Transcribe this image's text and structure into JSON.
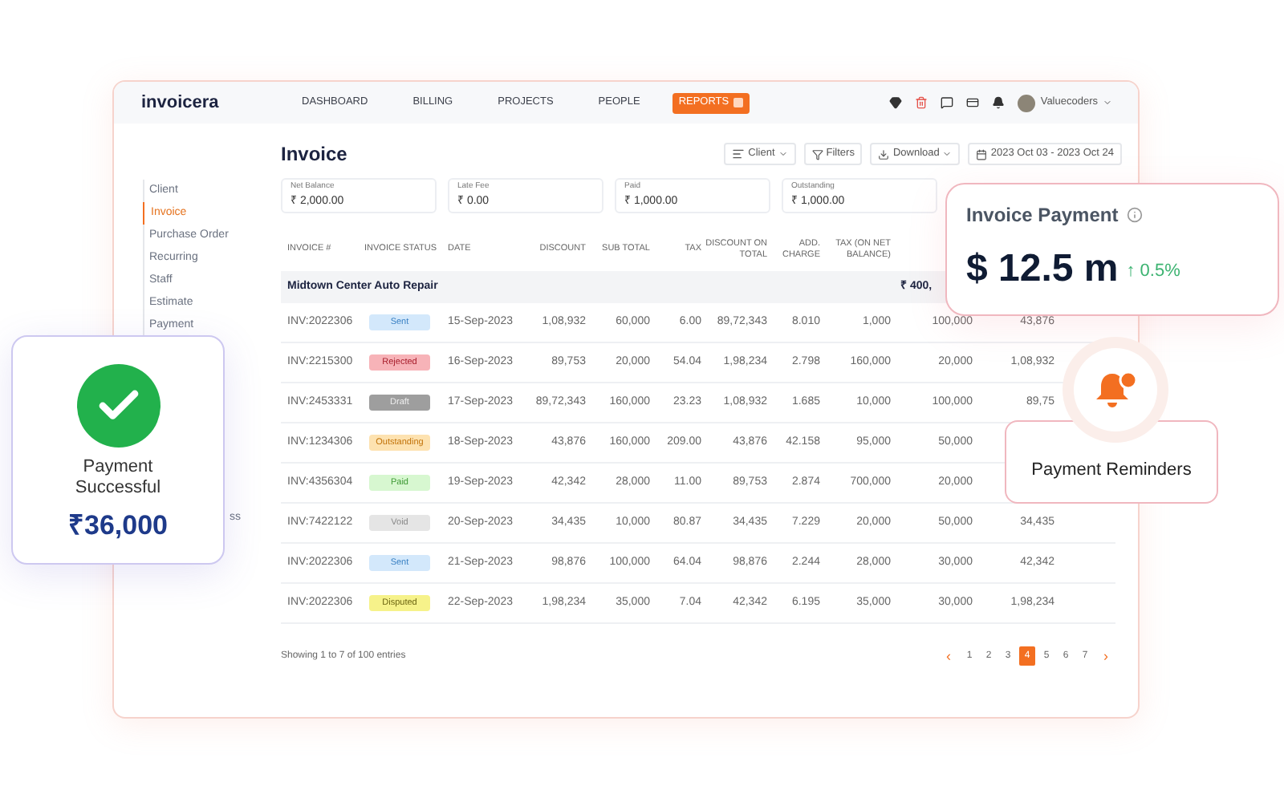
{
  "brand": "invoicera",
  "nav": [
    {
      "label": "DASHBOARD",
      "selected": false
    },
    {
      "label": "BILLING",
      "selected": false
    },
    {
      "label": "PROJECTS",
      "selected": false
    },
    {
      "label": "PEOPLE",
      "selected": false
    },
    {
      "label": "REPORTS",
      "selected": true
    }
  ],
  "user": "Valuecoders",
  "sidebar": [
    {
      "label": "Client",
      "selected": false,
      "clipped": false
    },
    {
      "label": "Invoice",
      "selected": true,
      "clipped": false
    },
    {
      "label": "Purchase Order",
      "selected": false,
      "clipped": false
    },
    {
      "label": "Recurring",
      "selected": false,
      "clipped": false
    },
    {
      "label": "Staff",
      "selected": false,
      "clipped": false
    },
    {
      "label": "Estimate",
      "selected": false,
      "clipped": false
    },
    {
      "label": "Payment",
      "selected": false,
      "clipped": false
    },
    {
      "label": "ss",
      "selected": false,
      "clipped": true
    }
  ],
  "page_title": "Invoice",
  "filters": [
    {
      "label": "Client",
      "kind": "dropdown"
    },
    {
      "label": "Filters",
      "kind": "filter"
    },
    {
      "label": "Download",
      "kind": "download"
    },
    {
      "label": "2023 Oct 03 - 2023 Oct 24",
      "kind": "date"
    }
  ],
  "summary": [
    {
      "label": "Net Balance",
      "value": "₹ 2,000.00"
    },
    {
      "label": "Late Fee",
      "value": "₹ 0.00"
    },
    {
      "label": "Paid",
      "value": "₹ 1,000.00"
    },
    {
      "label": "Outstanding",
      "value": "₹ 1,000.00"
    }
  ],
  "table": {
    "columns": [
      "INVOICE #",
      "INVOICE STATUS",
      "DATE",
      "DISCOUNT",
      "SUB TOTAL",
      "TAX",
      "DISCOUNT ON TOTAL",
      "ADD. CHARGE",
      "TAX (ON NET BALANCE)"
    ],
    "group": {
      "name": "Midtown Center Auto Repair",
      "amount": "₹ 400,"
    },
    "rows": [
      {
        "cells": [
          "INV:2022306",
          {
            "label": "Sent",
            "kind": "sent",
            "color": "#d3e8fb"
          },
          "15-Sep-2023",
          "1,08,932",
          "60,000",
          "6.00",
          "89,72,343",
          "8.010",
          "1,000",
          "100,000",
          "43,876"
        ]
      },
      {
        "cells": [
          "INV:2215300",
          {
            "label": "Rejected",
            "kind": "rejected",
            "color": "#f7b3b8"
          },
          "16-Sep-2023",
          "89,753",
          "20,000",
          "54.04",
          "1,98,234",
          "2.798",
          "160,000",
          "20,000",
          "1,08,932"
        ]
      },
      {
        "cells": [
          "INV:2453331",
          {
            "label": "Draft",
            "kind": "draft",
            "color": "#9e9e9e"
          },
          "17-Sep-2023",
          "89,72,343",
          "160,000",
          "23.23",
          "1,08,932",
          "1.685",
          "10,000",
          "100,000",
          "89,75"
        ]
      },
      {
        "cells": [
          "INV:1234306",
          {
            "label": "Outstanding",
            "kind": "outstanding",
            "color": "#fde2b0"
          },
          "18-Sep-2023",
          "43,876",
          "160,000",
          "209.00",
          "43,876",
          "42.158",
          "95,000",
          "50,000"
        ]
      },
      {
        "cells": [
          "INV:4356304",
          {
            "label": "Paid",
            "kind": "paid",
            "color": "#d7f7d0"
          },
          "19-Sep-2023",
          "42,342",
          "28,000",
          "11.00",
          "89,753",
          "2.874",
          "700,000",
          "20,000"
        ]
      },
      {
        "cells": [
          "INV:7422122",
          {
            "label": "Void",
            "kind": "void",
            "color": "#e5e5e5"
          },
          "20-Sep-2023",
          "34,435",
          "10,000",
          "80.87",
          "34,435",
          "7.229",
          "20,000",
          "50,000",
          "34,435"
        ]
      },
      {
        "cells": [
          "INV:2022306",
          {
            "label": "Sent",
            "kind": "sent",
            "color": "#d3e8fb"
          },
          "21-Sep-2023",
          "98,876",
          "100,000",
          "64.04",
          "98,876",
          "2.244",
          "28,000",
          "30,000",
          "42,342"
        ]
      },
      {
        "cells": [
          "INV:2022306",
          {
            "label": "Disputed",
            "kind": "disputed",
            "color": "#f6f28a"
          },
          "22-Sep-2023",
          "1,98,234",
          "35,000",
          "7.04",
          "42,342",
          "6.195",
          "35,000",
          "30,000",
          "1,98,234"
        ]
      }
    ]
  },
  "footer": {
    "entries": "Showing 1 to 7 of 100 entries",
    "prev": "‹",
    "next": "›",
    "pages": [
      {
        "label": "1",
        "selected": false
      },
      {
        "label": "2",
        "selected": false
      },
      {
        "label": "3",
        "selected": false
      },
      {
        "label": "4",
        "selected": true
      },
      {
        "label": "5",
        "selected": false
      },
      {
        "label": "6",
        "selected": false
      },
      {
        "label": "7",
        "selected": false
      }
    ]
  },
  "payment_card": {
    "title": "Payment Successful",
    "amount": "₹36,000"
  },
  "invoice_card": {
    "title": "Invoice Payment",
    "value": "$ 12.5 m",
    "change": "↑ 0.5%"
  },
  "reminder_card": {
    "title": "Payment Reminders"
  }
}
